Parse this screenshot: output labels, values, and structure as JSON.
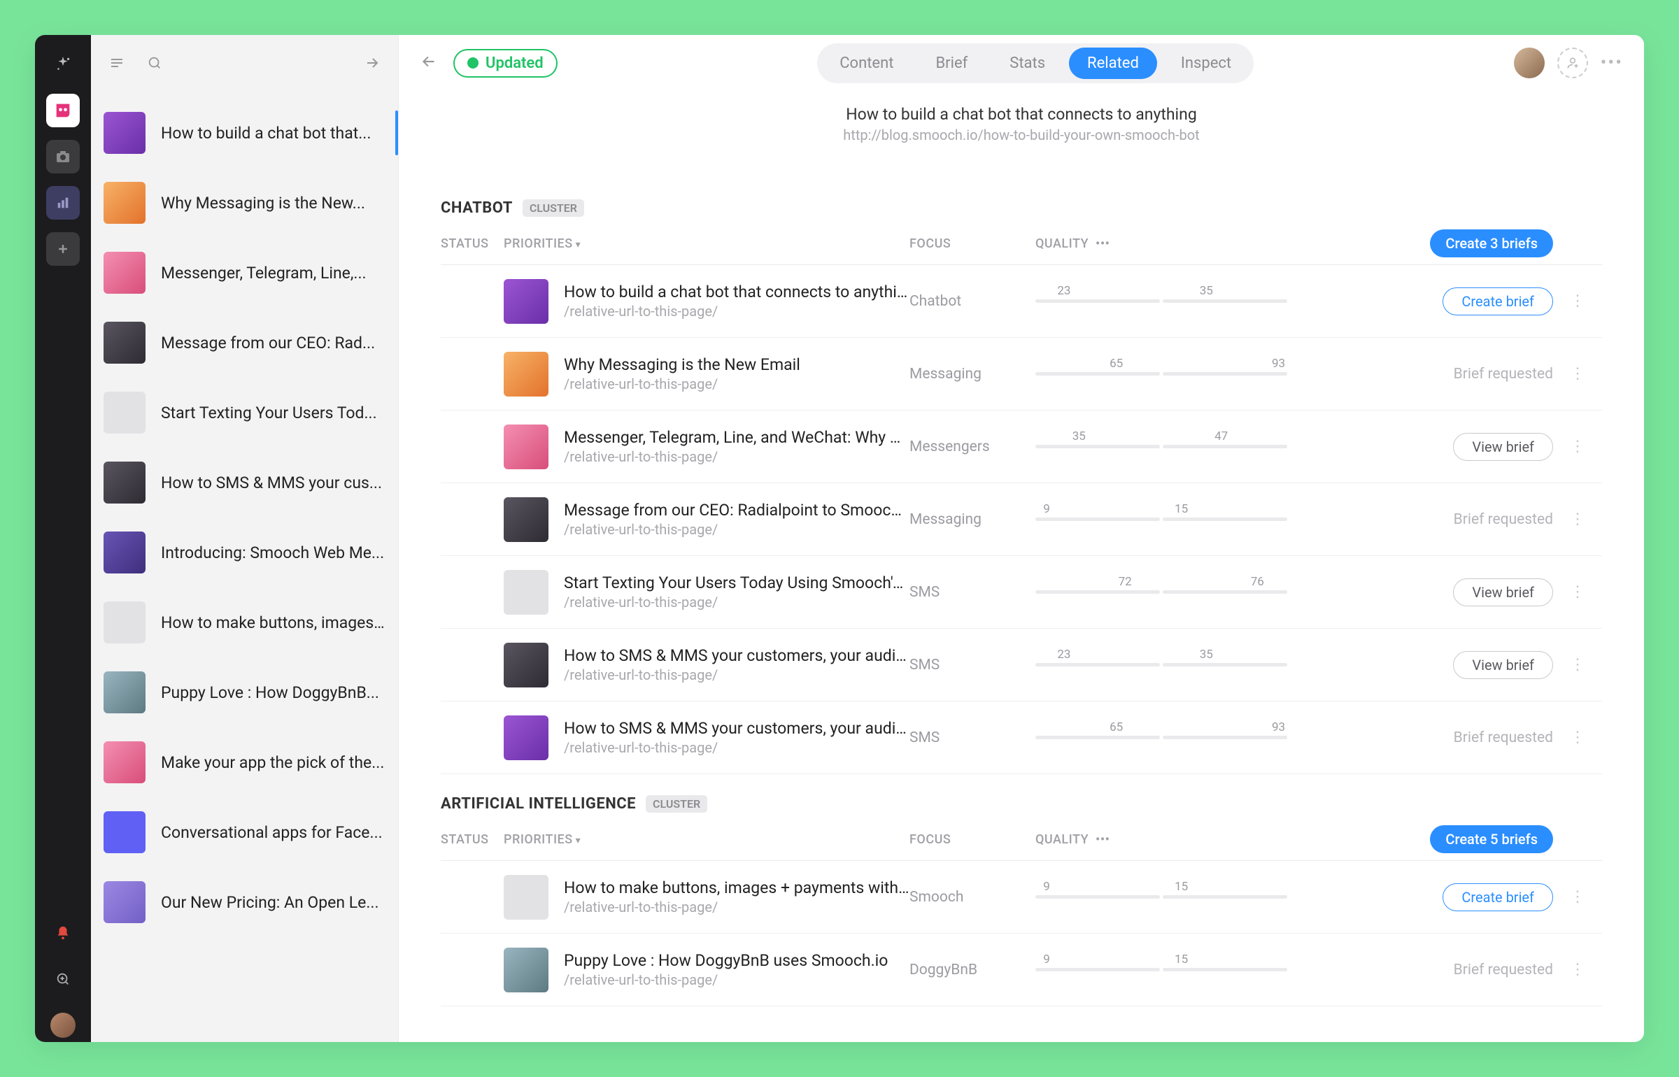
{
  "rail": {
    "items": [
      {
        "name": "sparkle-icon"
      },
      {
        "name": "app-badge",
        "active": true
      },
      {
        "name": "camera-icon"
      },
      {
        "name": "analytics-icon"
      },
      {
        "name": "plus-icon"
      }
    ],
    "bottom": [
      {
        "name": "bell-icon"
      },
      {
        "name": "zoom-icon"
      },
      {
        "name": "user-avatar"
      }
    ]
  },
  "sidebar": {
    "items": [
      {
        "title": "How to build a chat bot that...",
        "thumb": "tc-purple",
        "selected": true
      },
      {
        "title": "Why Messaging is the New...",
        "thumb": "tc-orange"
      },
      {
        "title": "Messenger, Telegram, Line,...",
        "thumb": "tc-pink"
      },
      {
        "title": "Message from our CEO: Rad...",
        "thumb": "tc-dark"
      },
      {
        "title": "Start Texting Your Users Tod...",
        "thumb": "tc-gray"
      },
      {
        "title": "How to SMS & MMS your cus...",
        "thumb": "tc-dark"
      },
      {
        "title": "Introducing: Smooch Web Me...",
        "thumb": "tc-dpurp"
      },
      {
        "title": "How to make buttons, images...",
        "thumb": "tc-gray"
      },
      {
        "title": "Puppy Love : How DoggyBnB...",
        "thumb": "tc-photo"
      },
      {
        "title": "Make your app the pick of the...",
        "thumb": "tc-pink"
      },
      {
        "title": "Conversational apps for Face...",
        "thumb": "tc-blue"
      },
      {
        "title": "Our New Pricing: An Open Le...",
        "thumb": "tc-lpurp"
      }
    ]
  },
  "header": {
    "status_label": "Updated",
    "tabs": [
      "Content",
      "Brief",
      "Stats",
      "Related",
      "Inspect"
    ],
    "active_tab": "Related"
  },
  "page": {
    "title": "How to build a chat bot that connects to anything",
    "url": "http://blog.smooch.io/how-to-build-your-own-smooch-bot"
  },
  "columns": {
    "status": "STATUS",
    "priorities": "PRIORITIES",
    "focus": "FOCUS",
    "quality": "QUALITY"
  },
  "clusters": [
    {
      "name": "CHATBOT",
      "tag": "CLUSTER",
      "create_label": "Create 3 briefs",
      "rows": [
        {
          "status": "#f2a63b",
          "thumb": "tc-purple",
          "title": "How to build a chat bot that connects to anything",
          "url": "/relative-url-to-this-page/",
          "focus": "Chatbot",
          "q1": 23,
          "q2": 35,
          "action": "create",
          "action_label": "Create brief"
        },
        {
          "status": "#25c46b",
          "thumb": "tc-orange",
          "title": "Why Messaging is the New Email",
          "url": "/relative-url-to-this-page/",
          "focus": "Messaging",
          "q1": 65,
          "q2": 93,
          "action": "requested",
          "action_label": "Brief requested"
        },
        {
          "status": "#f2a63b",
          "thumb": "tc-pink",
          "title": "Messenger, Telegram, Line, and WeChat: Why We...",
          "url": "/relative-url-to-this-page/",
          "focus": "Messengers",
          "q1": 35,
          "q2": 47,
          "action": "view",
          "action_label": "View brief"
        },
        {
          "status": "#2b8eff",
          "thumb": "tc-dark",
          "title": "Message from our CEO: Radialpoint to Smooch and...",
          "url": "/relative-url-to-this-page/",
          "focus": "Messaging",
          "q1": 9,
          "q2": 15,
          "action": "requested",
          "action_label": "Brief requested"
        },
        {
          "status": "#f2a63b",
          "thumb": "tc-gray",
          "title": "Start Texting Your Users Today Using Smooch's S...",
          "url": "/relative-url-to-this-page/",
          "focus": "SMS",
          "q1": 72,
          "q2": 76,
          "action": "view",
          "action_label": "View brief"
        },
        {
          "status": "#f2a63b",
          "thumb": "tc-dark",
          "title": "How to SMS & MMS your customers, your audience...",
          "url": "/relative-url-to-this-page/",
          "focus": "SMS",
          "q1": 23,
          "q2": 35,
          "action": "view",
          "action_label": "View brief"
        },
        {
          "status": "#f5d93b",
          "thumb": "tc-purple",
          "title": "How to SMS & MMS your customers, your audience...",
          "url": "/relative-url-to-this-page/",
          "focus": "SMS",
          "q1": 65,
          "q2": 93,
          "action": "requested",
          "action_label": "Brief requested"
        }
      ]
    },
    {
      "name": "ARTIFICIAL INTELLIGENCE",
      "tag": "CLUSTER",
      "create_label": "Create 5 briefs",
      "rows": [
        {
          "status": "#2b8eff",
          "thumb": "tc-gray",
          "title": "How to make buttons, images + payments with Sm...",
          "url": "/relative-url-to-this-page/",
          "focus": "Smooch",
          "q1": 9,
          "q2": 15,
          "action": "create",
          "action_label": "Create brief"
        },
        {
          "status": "#25c46b",
          "thumb": "tc-photo",
          "title": "Puppy Love : How DoggyBnB uses Smooch.io",
          "url": "/relative-url-to-this-page/",
          "focus": "DoggyBnB",
          "q1": 9,
          "q2": 15,
          "action": "requested",
          "action_label": "Brief requested"
        }
      ]
    }
  ]
}
